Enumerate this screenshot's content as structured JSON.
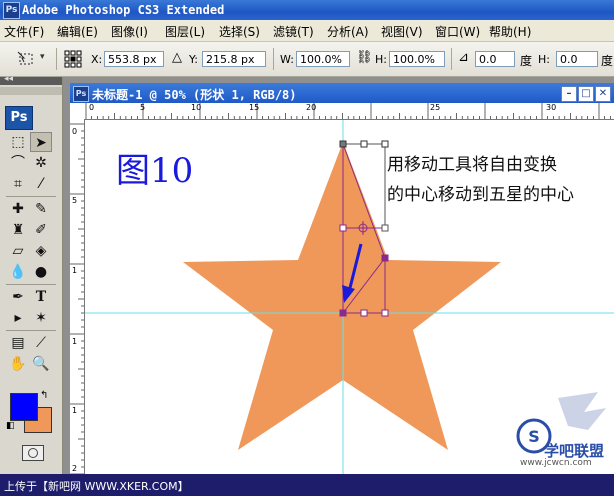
{
  "app": {
    "title": "Adobe Photoshop CS3 Extended",
    "badge": "Ps"
  },
  "menu": [
    {
      "label": "文件(F)"
    },
    {
      "label": "编辑(E)"
    },
    {
      "label": "图像(I)"
    },
    {
      "label": "图层(L)"
    },
    {
      "label": "选择(S)"
    },
    {
      "label": "滤镜(T)"
    },
    {
      "label": "分析(A)"
    },
    {
      "label": "视图(V)"
    },
    {
      "label": "窗口(W)"
    },
    {
      "label": "帮助(H)"
    }
  ],
  "options": {
    "x_label": "X:",
    "x_value": "553.8 px",
    "y_label": "Y:",
    "y_value": "215.8 px",
    "w_label": "W:",
    "w_value": "100.0%",
    "h_label": "H:",
    "h_value": "100.0%",
    "angle_value": "0.0",
    "angle_unit": "度",
    "hskew_label": "H:",
    "hskew_value": "0.0",
    "hskew_unit": "度"
  },
  "toolbox": {
    "logo": "Ps",
    "foreground_color": "#0000ff",
    "background_color": "#f0975a"
  },
  "document": {
    "title": "未标题-1 @ 50% (形状 1, RGB/8)",
    "badge": "Ps",
    "ruler_h": [
      "0",
      "5",
      "10",
      "15",
      "20",
      "25",
      "30"
    ],
    "ruler_v": [
      "0",
      "5",
      "1",
      "1",
      "1",
      "2"
    ],
    "figure_label": "图10",
    "annotation_lines": [
      "用移动工具将自由变换",
      "的中心移动到五星的中心"
    ],
    "star_color": "#f0975a",
    "guide_color": "#66e0e8",
    "transform_color": "#8a2b8a",
    "arrow_color": "#1a1adc"
  },
  "statusbar": {
    "text": "上传于【新吧网 WWW.XKER.COM】"
  },
  "watermark": {
    "text": "学吧联盟",
    "subtext": "www.jcwcn.com"
  }
}
